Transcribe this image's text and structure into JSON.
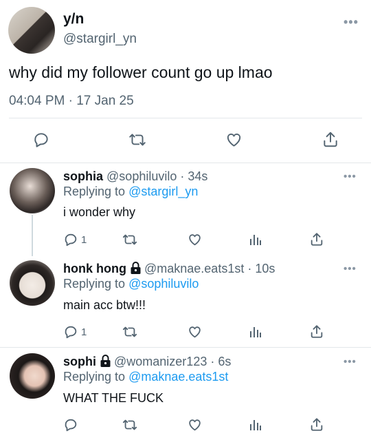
{
  "main_tweet": {
    "name": "y/n",
    "handle": "@stargirl_yn",
    "text": "why did my follower count go up lmao",
    "time": "04:04 PM",
    "date": "17 Jan 25",
    "separator": " · ",
    "more": "•••"
  },
  "replies": [
    {
      "name": "sophia",
      "handle": "@sophiluvilo",
      "time": "34s",
      "replying_prefix": "Replying to ",
      "replying_to": "@stargirl_yn",
      "text": "i wonder why",
      "reply_count": "1",
      "locked": false
    },
    {
      "name": "honk hong",
      "handle": "@maknae.eats1st",
      "time": "10s",
      "replying_prefix": "Replying to ",
      "replying_to": "@sophiluvilo",
      "text": "main acc btw!!!",
      "reply_count": "1",
      "locked": true
    },
    {
      "name": "sophi",
      "handle": "@womanizer123",
      "time": "6s",
      "replying_prefix": "Replying to ",
      "replying_to": "@maknae.eats1st",
      "text": "WHAT THE FUCK",
      "reply_count": "",
      "locked": true
    }
  ],
  "dot": " · ",
  "colors": {
    "link": "#1d9bf0",
    "muted": "#536471",
    "icon": "#536471"
  },
  "icons": [
    "reply-icon",
    "retweet-icon",
    "like-icon",
    "views-icon",
    "share-icon",
    "lock-icon"
  ]
}
